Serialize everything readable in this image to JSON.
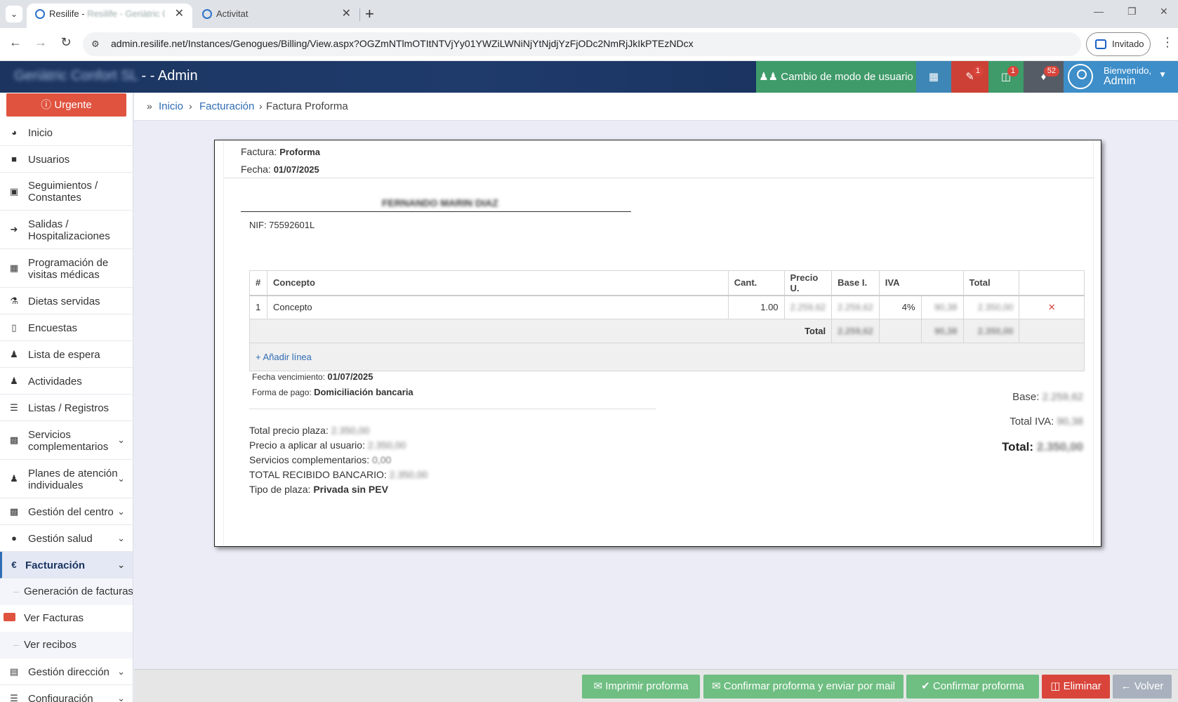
{
  "browser": {
    "tabs": [
      {
        "title": "Resilife - Geriàtric Confort SL",
        "active": true
      },
      {
        "title": "Activitat",
        "active": false
      }
    ],
    "url": "admin.resilife.net/Instances/Genogues/Billing/View.aspx?OGZmNTlmOTItNTVjYy01YWZiLWNiNjYtNjdjYzFjODc2NmRjJkIkPTEzNDcx",
    "profile_label": "Invitado",
    "icons": {
      "back": "arrow-left-icon",
      "forward": "arrow-right-icon",
      "reload": "reload-icon",
      "site": "site-info-icon",
      "menu": "kebab-menu-icon"
    }
  },
  "header": {
    "company": "Geriàtric Confort SL",
    "suffix": " -  - Admin",
    "mode_button": "Cambio de modo de usuario",
    "doc_badge": "1",
    "xls_badge": "1",
    "bell_badge": "52",
    "welcome": "Bienvenido,",
    "user": "Admin",
    "colors": {
      "header_bg": "#1b3560",
      "green": "#3f9b6a",
      "blue": "#3d86b5",
      "red": "#cc4035",
      "grey": "#555c66"
    }
  },
  "sidebar": {
    "urgent": "Urgente",
    "items": [
      {
        "label": "Inicio",
        "icon": "dashboard-icon"
      },
      {
        "label": "Usuarios",
        "icon": "address-book-icon"
      },
      {
        "label": "Seguimientos / Constantes",
        "icon": "note-icon"
      },
      {
        "label": "Salidas / Hospitalizaciones",
        "icon": "sign-out-icon"
      },
      {
        "label": "Programación de visitas médicas",
        "icon": "calendar-icon"
      },
      {
        "label": "Dietas servidas",
        "icon": "cutlery-icon"
      },
      {
        "label": "Encuestas",
        "icon": "file-icon"
      },
      {
        "label": "Lista de espera",
        "icon": "users-icon"
      },
      {
        "label": "Actividades",
        "icon": "users-icon"
      },
      {
        "label": "Listas / Registros",
        "icon": "list-icon"
      },
      {
        "label": "Servicios complementarios",
        "icon": "clipboard-icon"
      },
      {
        "label": "Planes de atención individuales",
        "icon": "users-icon"
      },
      {
        "label": "Gestión del centro",
        "icon": "building-icon"
      },
      {
        "label": "Gestión salud",
        "icon": "pills-icon"
      },
      {
        "label": "Facturación",
        "icon": "euro-icon"
      },
      {
        "label": "Gestión dirección",
        "icon": "briefcase-icon"
      },
      {
        "label": "Configuración",
        "icon": "list-icon"
      }
    ],
    "sub_items": [
      "Generación de facturas",
      "Ver Facturas",
      "Ver recibos"
    ]
  },
  "breadcrumb": {
    "home": "Inicio",
    "section": "Facturación",
    "current": "Factura Proforma"
  },
  "invoice": {
    "factura_label": "Factura:",
    "factura_value": "Proforma",
    "fecha_label": "Fecha:",
    "fecha_value": "01/07/2025",
    "client_name": "FERNANDO MARIN DIAZ",
    "nif": "NIF: 75592601L",
    "columns": [
      "#",
      "Concepto",
      "Cant.",
      "Precio U.",
      "Base I.",
      "IVA",
      "",
      "Total",
      ""
    ],
    "line": {
      "num": "1",
      "concepto": "Concepto",
      "cant": "1.00",
      "precio": "2.259,62",
      "base": "2.259,62",
      "iva_pct": "4%",
      "iva": "90,38",
      "total": "2.350,00"
    },
    "total_row": {
      "label": "Total",
      "base": "2.259,62",
      "iva": "90,38",
      "total": "2.350,00"
    },
    "add_line": "Añadir línea",
    "vencimiento_label": "Fecha vencimiento:",
    "vencimiento_value": "01/07/2025",
    "pago_label": "Forma de pago:",
    "pago_value": "Domiciliación bancaria",
    "totals": [
      {
        "label": "Total precio plaza:",
        "value": "2.350,00"
      },
      {
        "label": "Precio a aplicar al usuario:",
        "value": "2.350,00"
      },
      {
        "label": "Servicios complementarios:",
        "value": "0,00"
      },
      {
        "label": "TOTAL RECIBIDO BANCARIO:",
        "value": "2.350,00"
      },
      {
        "label": "Tipo de plaza:",
        "value": "Privada sin PEV"
      }
    ],
    "summary": {
      "base_label": "Base:",
      "base": "2.259,62",
      "iva_label": "Total IVA:",
      "iva": "90,38",
      "total_label": "Total:",
      "total": "2.350,00"
    }
  },
  "actions": {
    "print": "Imprimir proforma",
    "confirm_mail": "Confirmar proforma y enviar por mail",
    "confirm": "Confirmar proforma",
    "delete": "Eliminar",
    "back": "Volver"
  }
}
